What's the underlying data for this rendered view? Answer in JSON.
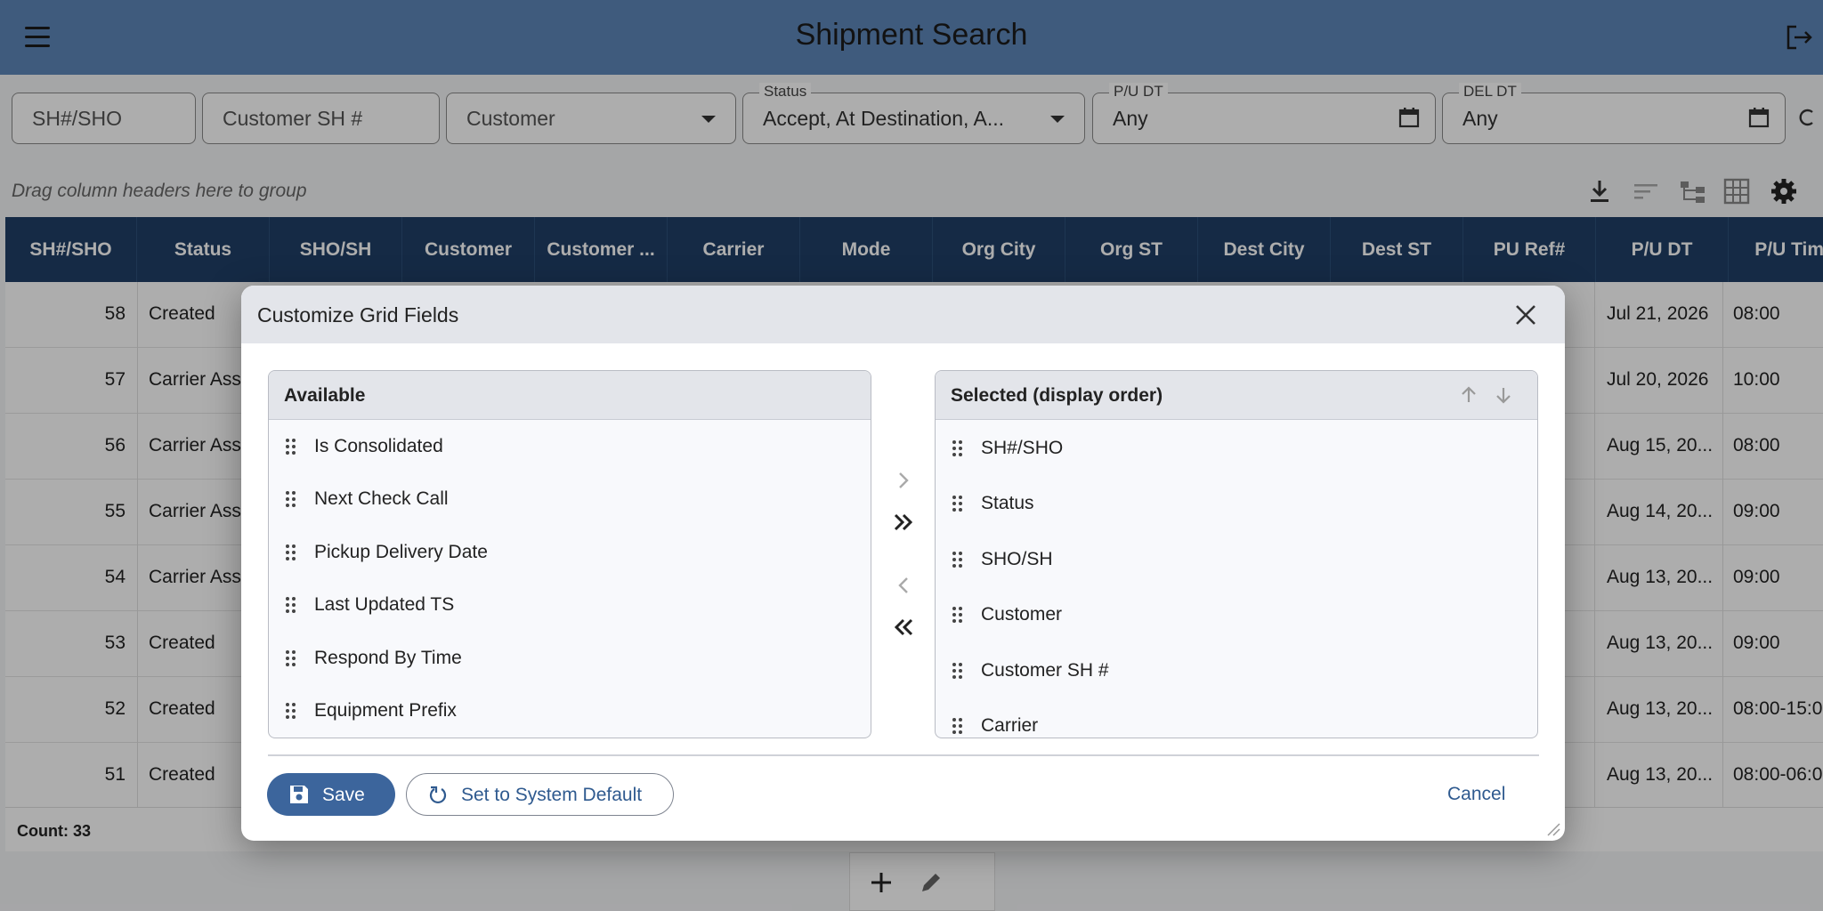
{
  "header": {
    "title": "Shipment Search"
  },
  "filters": {
    "sh": {
      "placeholder": "SH#/SHO"
    },
    "customer_sh": {
      "placeholder": "Customer SH #"
    },
    "customer": {
      "placeholder": "Customer"
    },
    "status": {
      "label": "Status",
      "value": "Accept, At Destination, A..."
    },
    "pu_dt": {
      "label": "P/U DT",
      "value": "Any"
    },
    "del_dt": {
      "label": "DEL DT",
      "value": "Any"
    }
  },
  "group_bar": {
    "hint": "Drag column headers here to group"
  },
  "grid": {
    "columns": [
      "SH#/SHO",
      "Status",
      "SHO/SH",
      "Customer",
      "Customer ...",
      "Carrier",
      "Mode",
      "Org City",
      "Org ST",
      "Dest City",
      "Dest ST",
      "PU Ref#",
      "P/U DT",
      "P/U Time"
    ],
    "rows": [
      {
        "id": "58",
        "status": "Created",
        "pu_dt": "Jul 21, 2026",
        "pu_time": "08:00"
      },
      {
        "id": "57",
        "status": "Carrier Ass",
        "pu_dt": "Jul 20, 2026",
        "pu_time": "10:00"
      },
      {
        "id": "56",
        "status": "Carrier Ass",
        "pu_dt": "Aug 15, 20...",
        "pu_time": "08:00"
      },
      {
        "id": "55",
        "status": "Carrier Ass",
        "pu_dt": "Aug 14, 20...",
        "pu_time": "09:00"
      },
      {
        "id": "54",
        "status": "Carrier Ass",
        "pu_dt": "Aug 13, 20...",
        "pu_time": "09:00"
      },
      {
        "id": "53",
        "status": "Created",
        "pu_dt": "Aug 13, 20...",
        "pu_time": "09:00"
      },
      {
        "id": "52",
        "status": "Created",
        "pu_dt": "Aug 13, 20...",
        "pu_time": "08:00-15:0"
      },
      {
        "id": "51",
        "status": "Created",
        "pu_dt": "Aug 13, 20...",
        "pu_time": "08:00-06:0"
      }
    ],
    "count_label": "Count: 33"
  },
  "dialog": {
    "title": "Customize Grid Fields",
    "available": {
      "title": "Available",
      "items": [
        "Is Consolidated",
        "Next Check Call",
        "Pickup Delivery Date",
        "Last Updated TS",
        "Respond By Time",
        "Equipment Prefix"
      ]
    },
    "selected": {
      "title": "Selected (display order)",
      "items": [
        "SH#/SHO",
        "Status",
        "SHO/SH",
        "Customer",
        "Customer SH #",
        "Carrier"
      ]
    },
    "save_label": "Save",
    "default_label": "Set to System Default",
    "cancel_label": "Cancel"
  },
  "colors": {
    "appbar": "#5e86b8",
    "grid_header": "#1f3f66",
    "primary": "#3c659c"
  }
}
